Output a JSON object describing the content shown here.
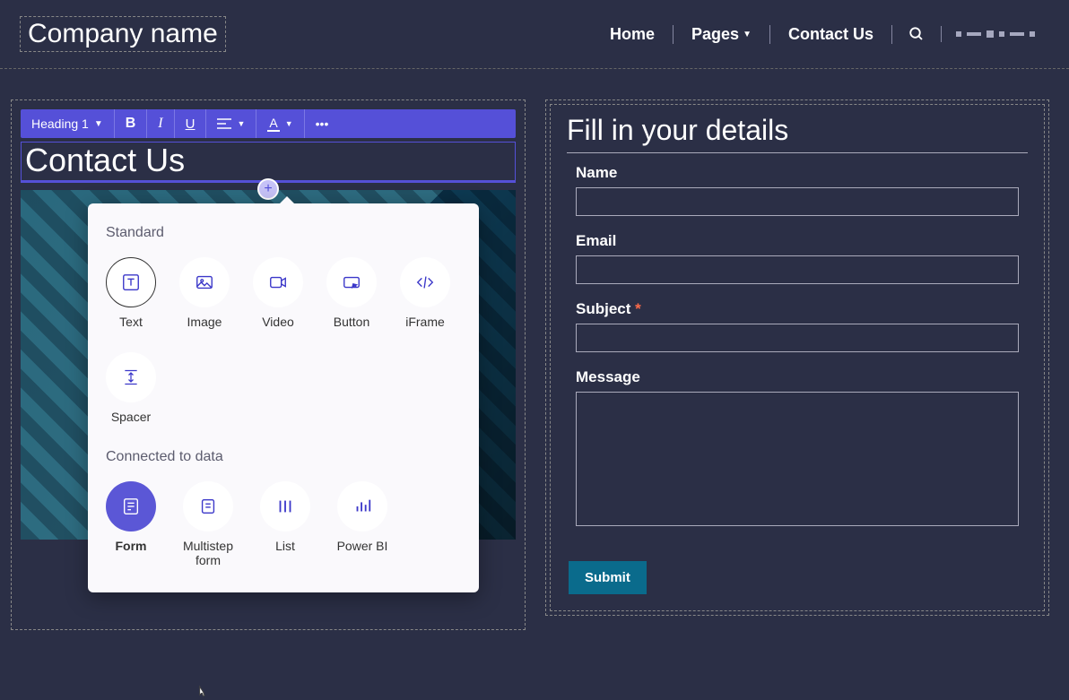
{
  "header": {
    "logo": "Company name",
    "nav": [
      "Home",
      "Pages",
      "Contact Us"
    ]
  },
  "editor_toolbar": {
    "style_label": "Heading 1"
  },
  "page": {
    "title": "Contact Us"
  },
  "popup": {
    "section1_title": "Standard",
    "section2_title": "Connected to data",
    "standard": [
      "Text",
      "Image",
      "Video",
      "Button",
      "iFrame",
      "Spacer"
    ],
    "connected": [
      "Form",
      "Multistep form",
      "List",
      "Power BI"
    ]
  },
  "form": {
    "title": "Fill in your details",
    "fields": {
      "name": "Name",
      "email": "Email",
      "subject": "Subject",
      "message": "Message"
    },
    "submit": "Submit"
  }
}
